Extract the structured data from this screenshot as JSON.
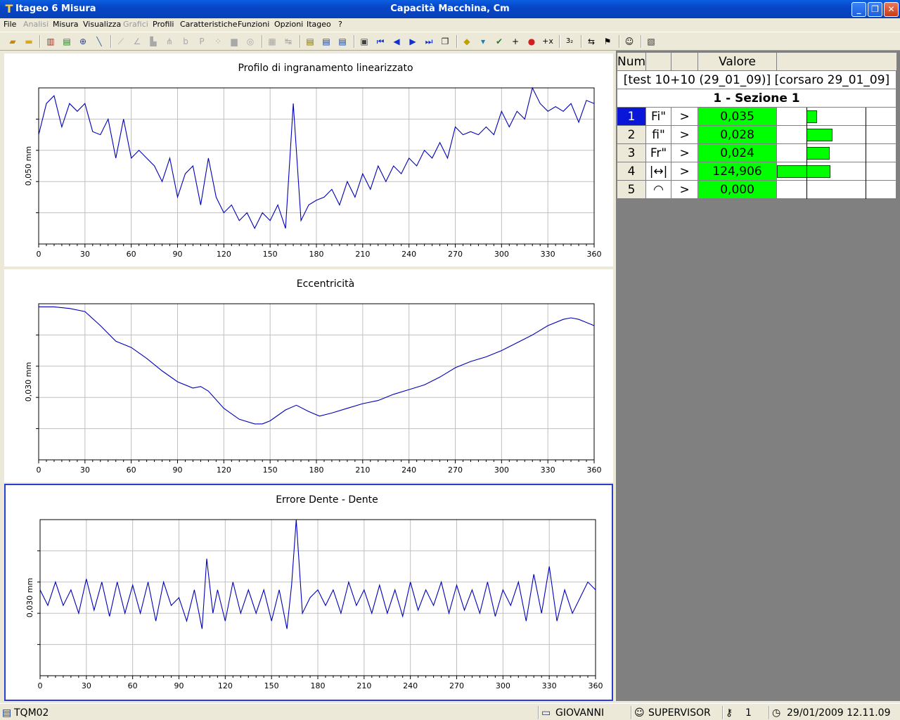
{
  "window": {
    "app_name": "Itageo 6 Misura",
    "title": "Capacità Macchina, Cm",
    "minimize_icon": "minimize-icon",
    "restore_icon": "restore-icon",
    "close_icon": "close-icon"
  },
  "menu": [
    {
      "label": "File",
      "enabled": true
    },
    {
      "label": "Analisi",
      "enabled": false
    },
    {
      "label": "Misura",
      "enabled": true
    },
    {
      "label": "Visualizza",
      "enabled": true
    },
    {
      "label": "Grafici",
      "enabled": false
    },
    {
      "label": "Profili",
      "enabled": true
    },
    {
      "label": "Caratteristiche",
      "enabled": true
    },
    {
      "label": "Funzioni",
      "enabled": true
    },
    {
      "label": "Opzioni",
      "enabled": true
    },
    {
      "label": "Itageo",
      "enabled": true
    },
    {
      "label": "?",
      "enabled": true
    }
  ],
  "toolbar": {
    "icons": [
      "open-folder-icon",
      "folder-icon",
      "chart-bars-icon",
      "color-bars-icon",
      "target-icon",
      "probe-icon",
      "line-chart-icon",
      "slope-icon",
      "histogram-icon",
      "tree-icon",
      "b-icon",
      "p-icon",
      "scatter-icon",
      "stack-icon",
      "circle-plot-icon",
      "doc-chart-icon",
      "span-icon",
      "note-icon",
      "report-icon",
      "report2-icon",
      "print-icon",
      "first-icon",
      "prev-icon",
      "next-icon",
      "last-icon",
      "copy-icon",
      "warning-icon",
      "cup-icon",
      "check-icon",
      "crosshair-icon",
      "record-icon",
      "plus-x-icon",
      "digits-icon",
      "arrows-icon",
      "flag-icon",
      "user-icon",
      "settings-icon"
    ],
    "plus_x_label": "+x",
    "digits_label": "3₂"
  },
  "charts": [
    {
      "name": "profile-chart",
      "title": "Profilo di ingranamento linearizzato",
      "ylabel": "0,050 mm",
      "xticks": [
        "0",
        "30",
        "60",
        "90",
        "120",
        "150",
        "180",
        "210",
        "240",
        "270",
        "300",
        "330",
        "360"
      ],
      "chart_data": {
        "type": "line",
        "title": "Profilo di ingranamento linearizzato",
        "ylabel": "0,050 mm",
        "xlim": [
          0,
          360
        ],
        "grid": true,
        "series": [
          {
            "x": [
              0,
              5,
              10,
              15,
              20,
              25,
              30,
              35,
              40,
              45,
              50,
              55,
              60,
              65,
              70,
              75,
              80,
              85,
              90,
              95,
              100,
              105,
              110,
              115,
              120,
              125,
              130,
              135,
              140,
              145,
              150,
              155,
              160,
              165,
              170,
              175,
              180,
              185,
              190,
              195,
              200,
              205,
              210,
              215,
              220,
              225,
              230,
              235,
              240,
              245,
              250,
              255,
              260,
              265,
              270,
              275,
              280,
              285,
              290,
              295,
              300,
              305,
              310,
              315,
              320,
              325,
              330,
              335,
              340,
              345,
              350,
              355,
              360
            ],
            "y": [
              0.7,
              0.9,
              0.95,
              0.75,
              0.9,
              0.85,
              0.9,
              0.72,
              0.7,
              0.8,
              0.55,
              0.8,
              0.55,
              0.6,
              0.55,
              0.5,
              0.4,
              0.55,
              0.3,
              0.45,
              0.5,
              0.25,
              0.55,
              0.3,
              0.2,
              0.25,
              0.15,
              0.2,
              0.1,
              0.2,
              0.15,
              0.25,
              0.1,
              0.9,
              0.15,
              0.25,
              0.28,
              0.3,
              0.35,
              0.25,
              0.4,
              0.3,
              0.45,
              0.35,
              0.5,
              0.4,
              0.5,
              0.45,
              0.55,
              0.5,
              0.6,
              0.55,
              0.65,
              0.55,
              0.75,
              0.7,
              0.72,
              0.7,
              0.75,
              0.7,
              0.85,
              0.75,
              0.85,
              0.8,
              1.0,
              0.9,
              0.85,
              0.88,
              0.85,
              0.9,
              0.78,
              0.92,
              0.9
            ]
          }
        ]
      }
    },
    {
      "name": "eccentricity-chart",
      "title": "Eccentricità",
      "ylabel": "0,030 mm",
      "xticks": [
        "0",
        "30",
        "60",
        "90",
        "120",
        "150",
        "180",
        "210",
        "240",
        "270",
        "300",
        "330",
        "360"
      ],
      "chart_data": {
        "type": "line",
        "title": "Eccentricità",
        "ylabel": "0,030 mm",
        "xlim": [
          0,
          360
        ],
        "grid": true,
        "series": [
          {
            "x": [
              0,
              10,
              20,
              30,
              40,
              50,
              60,
              70,
              80,
              90,
              100,
              105,
              110,
              120,
              130,
              140,
              145,
              150,
              160,
              167,
              175,
              182,
              190,
              200,
              210,
              220,
              230,
              240,
              250,
              260,
              270,
              280,
              290,
              300,
              310,
              320,
              330,
              340,
              345,
              350,
              355,
              360
            ],
            "y": [
              0.98,
              0.98,
              0.97,
              0.95,
              0.86,
              0.76,
              0.72,
              0.65,
              0.57,
              0.5,
              0.46,
              0.47,
              0.44,
              0.33,
              0.26,
              0.23,
              0.23,
              0.25,
              0.32,
              0.35,
              0.31,
              0.28,
              0.3,
              0.33,
              0.36,
              0.38,
              0.42,
              0.45,
              0.48,
              0.53,
              0.59,
              0.63,
              0.66,
              0.7,
              0.75,
              0.8,
              0.86,
              0.9,
              0.91,
              0.9,
              0.88,
              0.86
            ]
          }
        ]
      }
    },
    {
      "name": "tooth-error-chart",
      "title": "Errore Dente - Dente",
      "ylabel": "0,030 mm",
      "xticks": [
        "0",
        "30",
        "60",
        "90",
        "120",
        "150",
        "180",
        "210",
        "240",
        "270",
        "300",
        "330",
        "360"
      ],
      "chart_data": {
        "type": "line",
        "title": "Errore Dente - Dente",
        "ylabel": "0,030 mm",
        "xlim": [
          0,
          360
        ],
        "grid": true,
        "series": [
          {
            "x": [
              0,
              5,
              10,
              15,
              20,
              25,
              30,
              35,
              40,
              45,
              50,
              55,
              60,
              65,
              70,
              75,
              80,
              85,
              90,
              95,
              100,
              105,
              108,
              112,
              115,
              120,
              125,
              130,
              135,
              140,
              145,
              150,
              155,
              160,
              163,
              166,
              170,
              175,
              180,
              185,
              190,
              195,
              200,
              205,
              210,
              215,
              220,
              225,
              230,
              235,
              240,
              245,
              250,
              255,
              260,
              265,
              270,
              275,
              280,
              285,
              290,
              295,
              300,
              305,
              310,
              315,
              320,
              325,
              330,
              335,
              340,
              345,
              350,
              355,
              360
            ],
            "y": [
              0.55,
              0.45,
              0.6,
              0.45,
              0.55,
              0.4,
              0.62,
              0.42,
              0.6,
              0.38,
              0.6,
              0.4,
              0.58,
              0.4,
              0.6,
              0.35,
              0.6,
              0.45,
              0.5,
              0.35,
              0.55,
              0.3,
              0.75,
              0.4,
              0.55,
              0.35,
              0.6,
              0.4,
              0.55,
              0.4,
              0.55,
              0.35,
              0.55,
              0.3,
              0.58,
              1.0,
              0.4,
              0.5,
              0.55,
              0.45,
              0.55,
              0.4,
              0.6,
              0.45,
              0.55,
              0.4,
              0.58,
              0.4,
              0.55,
              0.38,
              0.6,
              0.42,
              0.55,
              0.45,
              0.6,
              0.4,
              0.58,
              0.42,
              0.55,
              0.4,
              0.6,
              0.38,
              0.55,
              0.45,
              0.6,
              0.35,
              0.65,
              0.4,
              0.7,
              0.35,
              0.55,
              0.4,
              0.5,
              0.6,
              0.55
            ]
          }
        ]
      }
    }
  ],
  "table": {
    "headers": [
      "Num",
      "",
      "",
      "Valore",
      ""
    ],
    "subtitle": "[test 10+10 (29_01_09)] [corsaro 29_01_09]",
    "section": "1 - Sezione 1",
    "rows": [
      {
        "num": "1",
        "symbol": "Fi\"",
        "op": ">",
        "value": "0,035",
        "bar": 0.2,
        "selected": true
      },
      {
        "num": "2",
        "symbol": "fi\"",
        "op": ">",
        "value": "0,028",
        "bar": 0.5,
        "selected": false
      },
      {
        "num": "3",
        "symbol": "Fr\"",
        "op": ">",
        "value": "0,024",
        "bar": 0.45,
        "selected": false
      },
      {
        "num": "4",
        "symbol": "|↔|",
        "op": ">",
        "value": "124,906",
        "bar": 1.0,
        "selected": false
      },
      {
        "num": "5",
        "symbol": "◠",
        "op": ">",
        "value": "0,000",
        "bar": 0,
        "selected": false
      }
    ]
  },
  "statusbar": {
    "db_icon": "database-icon",
    "db": "TQM02",
    "user_icon": "computer-icon",
    "user": "GIOVANNI",
    "role_icon": "supervisor-icon",
    "role": "SUPERVISOR",
    "key_icon": "key-icon",
    "level": "1",
    "clock_icon": "clock-icon",
    "datetime": "29/01/2009 12.11.09"
  }
}
